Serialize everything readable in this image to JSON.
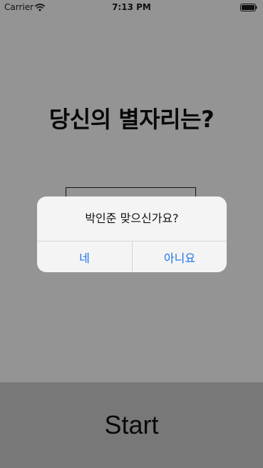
{
  "status_bar": {
    "carrier": "Carrier",
    "time": "7:13 PM"
  },
  "main": {
    "title": "당신의 별자리는?",
    "start_label": "Start"
  },
  "alert": {
    "message": "박인준 맞으신가요?",
    "yes_label": "네",
    "no_label": "아니요"
  },
  "colors": {
    "accent": "#1a73e8",
    "overlay": "#000000",
    "start_bar": "#cfcfcf"
  }
}
